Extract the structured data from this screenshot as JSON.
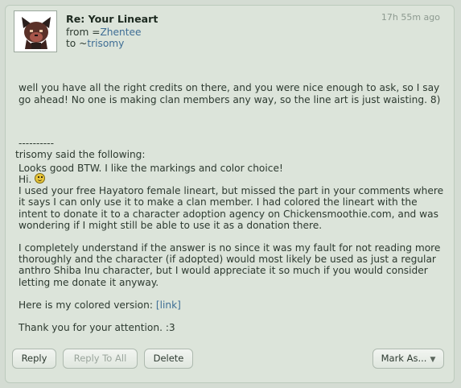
{
  "message": {
    "subject": "Re: Your Lineart",
    "from_prefix": "from =",
    "from_user": "Zhentee",
    "to_prefix": "to ~",
    "to_user": "trisomy",
    "time": "17h 55m ago",
    "body_line1": "well you have all the right credits on there, and you were nice enough to ask, so I say go ahead! No one is making clan members any way, so the line art is just waisting. 8)",
    "body_line2": "Looks good BTW. I like the markings and color choice!",
    "separator": "----------",
    "quoted_header": "trisomy said the following:",
    "quote_hi": "Hi.",
    "quote_p1": "I used your free Hayatoro female lineart, but missed the part in your comments where it says I can only use it to make a clan member. I had colored the lineart with the intent to donate it to a character adoption agency on Chickensmoothie.com, and was wondering if I might still be able to use it as a donation there.",
    "quote_p2": "I completely understand if the answer is no since it was my fault for not reading more thoroughly and the character (if adopted) would most likely be used as just a regular anthro Shiba Inu character, but I would appreciate it so much if you would consider letting me donate it anyway.",
    "quote_p3_prefix": "Here is my colored version: ",
    "quote_link": "[link]",
    "quote_p4": "Thank you for your attention. :3"
  },
  "actions": {
    "reply": "Reply",
    "reply_all": "Reply To All",
    "delete": "Delete",
    "mark_as": "Mark As..."
  },
  "icons": {
    "smiley": "smiley-icon",
    "avatar": "avatar-icon",
    "dropdown": "chevron-down-icon"
  }
}
